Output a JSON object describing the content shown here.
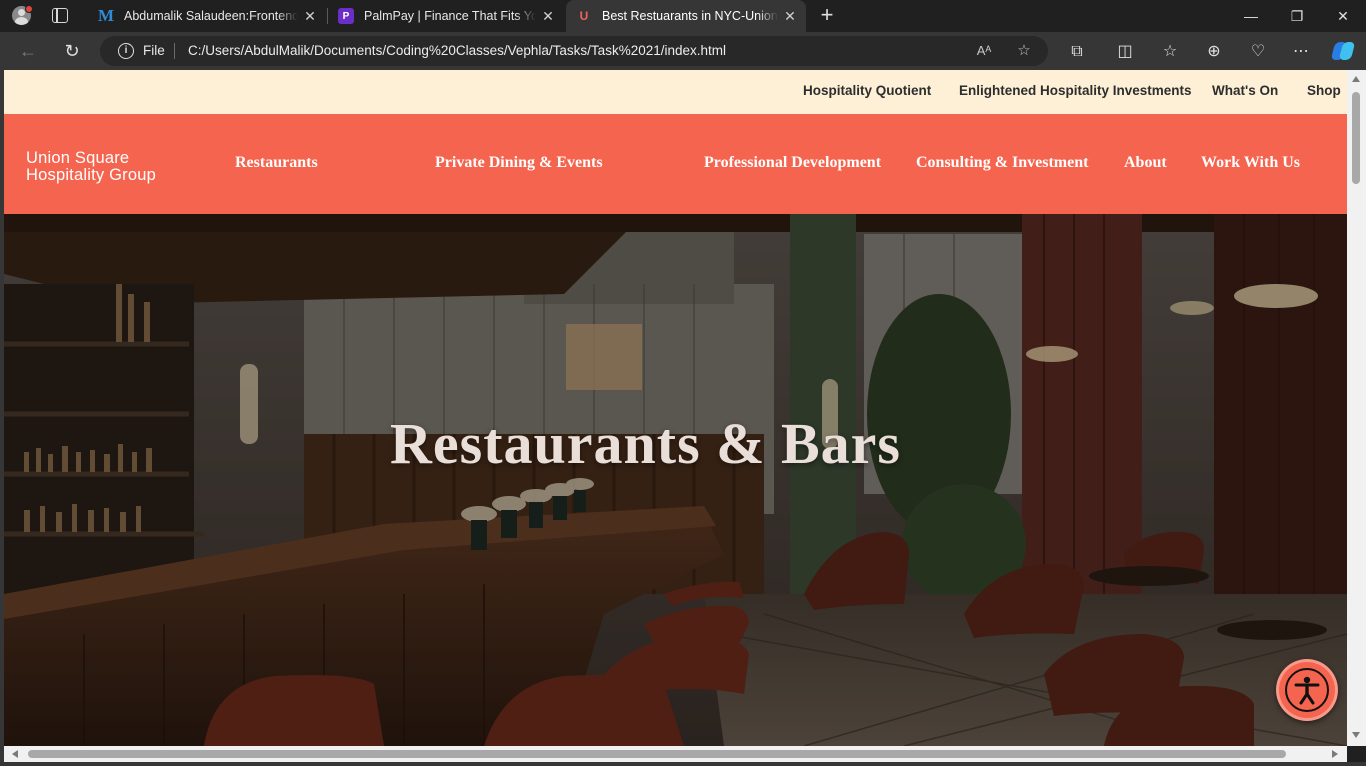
{
  "browser": {
    "tabs": [
      {
        "title": "Abdumalik Salaudeen:Frontend Developer",
        "favicon": "M",
        "active": false
      },
      {
        "title": "PalmPay | Finance That Fits Your Life",
        "favicon": "P",
        "active": false
      },
      {
        "title": "Best Restuarants in NYC-Union Square",
        "favicon": "U",
        "active": true
      }
    ],
    "new_tab_label": "+",
    "address": {
      "scheme_label": "File",
      "url": "C:/Users/AbdulMalik/Documents/Coding%20Classes/Vephla/Tasks/Task%2021/index.html"
    },
    "icons": [
      "profile-icon",
      "tab-actions-icon",
      "back-icon",
      "refresh-icon",
      "info-icon",
      "read-aloud-icon",
      "favorite-star-icon",
      "extensions-icon",
      "split-screen-icon",
      "favorites-icon",
      "collections-icon",
      "browser-essentials-icon",
      "more-icon",
      "copilot-icon",
      "minimize-icon",
      "restore-icon",
      "close-icon"
    ]
  },
  "site": {
    "utility_links": [
      "Hospitality Quotient",
      "Enlightened Hospitality Investments",
      "What's On",
      "Shop"
    ],
    "logo": {
      "line1": "Union Square",
      "line2": "Hospitality Group"
    },
    "nav_links": [
      "Restaurants",
      "Private Dining & Events",
      "Professional Development",
      "Consulting & Investment",
      "About",
      "Work With Us"
    ],
    "hero_title": "Restaurants & Bars",
    "colors": {
      "brand_coral": "#f5644e",
      "utility_cream": "#fdf0d6",
      "hero_text": "#e9dfd8"
    }
  },
  "accessibility_button": {
    "icon": "accessibility-icon"
  }
}
